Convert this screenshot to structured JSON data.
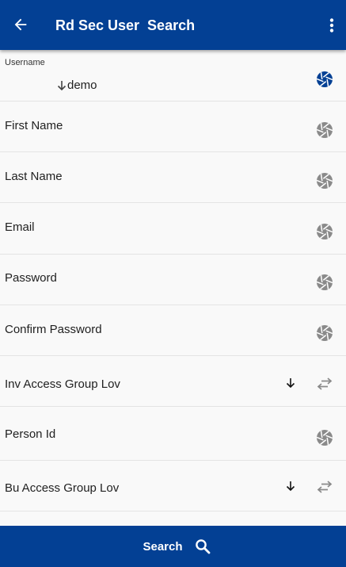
{
  "header": {
    "title": "Rd Sec User  Search",
    "back_icon": "arrow-left-icon",
    "menu_icon": "more-vertical-icon"
  },
  "colors": {
    "primary": "#034094",
    "icon_active": "#034094",
    "icon_inactive": "#8a8a8a"
  },
  "fields": [
    {
      "label": "Username",
      "value": "demo",
      "icon": "camera-aperture-icon",
      "active": true
    },
    {
      "label": "First Name",
      "icon": "camera-aperture-icon"
    },
    {
      "label": "Last Name",
      "icon": "camera-aperture-icon"
    },
    {
      "label": "Email",
      "icon": "camera-aperture-icon"
    },
    {
      "label": "Password",
      "icon": "camera-aperture-icon"
    },
    {
      "label": "Confirm Password",
      "icon": "camera-aperture-icon"
    },
    {
      "label": "Inv Access Group Lov",
      "icon": "swap-icon",
      "lov": true
    },
    {
      "label": "Person Id",
      "icon": "camera-aperture-icon"
    },
    {
      "label": "Bu Access Group Lov",
      "icon": "swap-icon",
      "lov": true
    }
  ],
  "footer": {
    "search_label": "Search",
    "search_icon": "search-icon"
  }
}
